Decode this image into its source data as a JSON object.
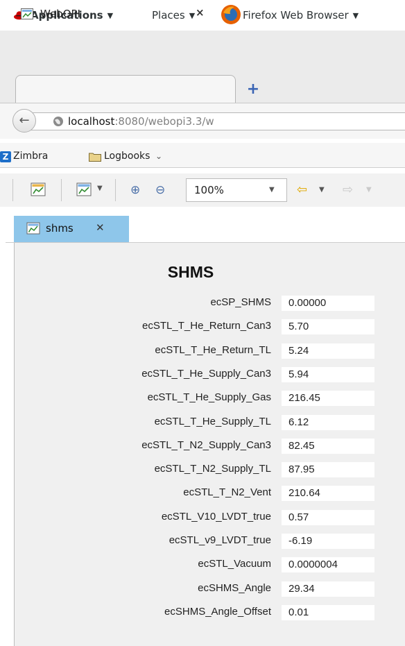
{
  "topbar": {
    "applications": "Applications",
    "places": "Places",
    "firefox": "Firefox Web Browser"
  },
  "browser": {
    "tab_title": "WebOPI",
    "url_host": "localhost",
    "url_rest": ":8080/webopi3.3/w",
    "bookmarks": [
      "Zimbra",
      "Logbooks"
    ]
  },
  "opi_toolbar": {
    "zoom_value": "100%"
  },
  "view_tab": {
    "label": "shms"
  },
  "display": {
    "title": "SHMS",
    "rows": [
      {
        "label": "ecSP_SHMS",
        "value": "0.00000"
      },
      {
        "label": "ecSTL_T_He_Return_Can3",
        "value": "5.70"
      },
      {
        "label": "ecSTL_T_He_Return_TL",
        "value": "5.24"
      },
      {
        "label": "ecSTL_T_He_Supply_Can3",
        "value": "5.94"
      },
      {
        "label": "ecSTL_T_He_Supply_Gas",
        "value": "216.45"
      },
      {
        "label": "ecSTL_T_He_Supply_TL",
        "value": "6.12"
      },
      {
        "label": "ecSTL_T_N2_Supply_Can3",
        "value": "82.45"
      },
      {
        "label": "ecSTL_T_N2_Supply_TL",
        "value": "87.95"
      },
      {
        "label": "ecSTL_T_N2_Vent",
        "value": "210.64"
      },
      {
        "label": "ecSTL_V10_LVDT_true",
        "value": "0.57"
      },
      {
        "label": "ecSTL_v9_LVDT_true",
        "value": "-6.19"
      },
      {
        "label": "ecSTL_Vacuum",
        "value": "0.0000004"
      },
      {
        "label": "ecSHMS_Angle",
        "value": "29.34"
      },
      {
        "label": "ecSHMS_Angle_Offset",
        "value": "0.01"
      }
    ]
  },
  "icons": {
    "accent": "#8ec6ea",
    "brand_zimbra": "#1e6fc9"
  }
}
